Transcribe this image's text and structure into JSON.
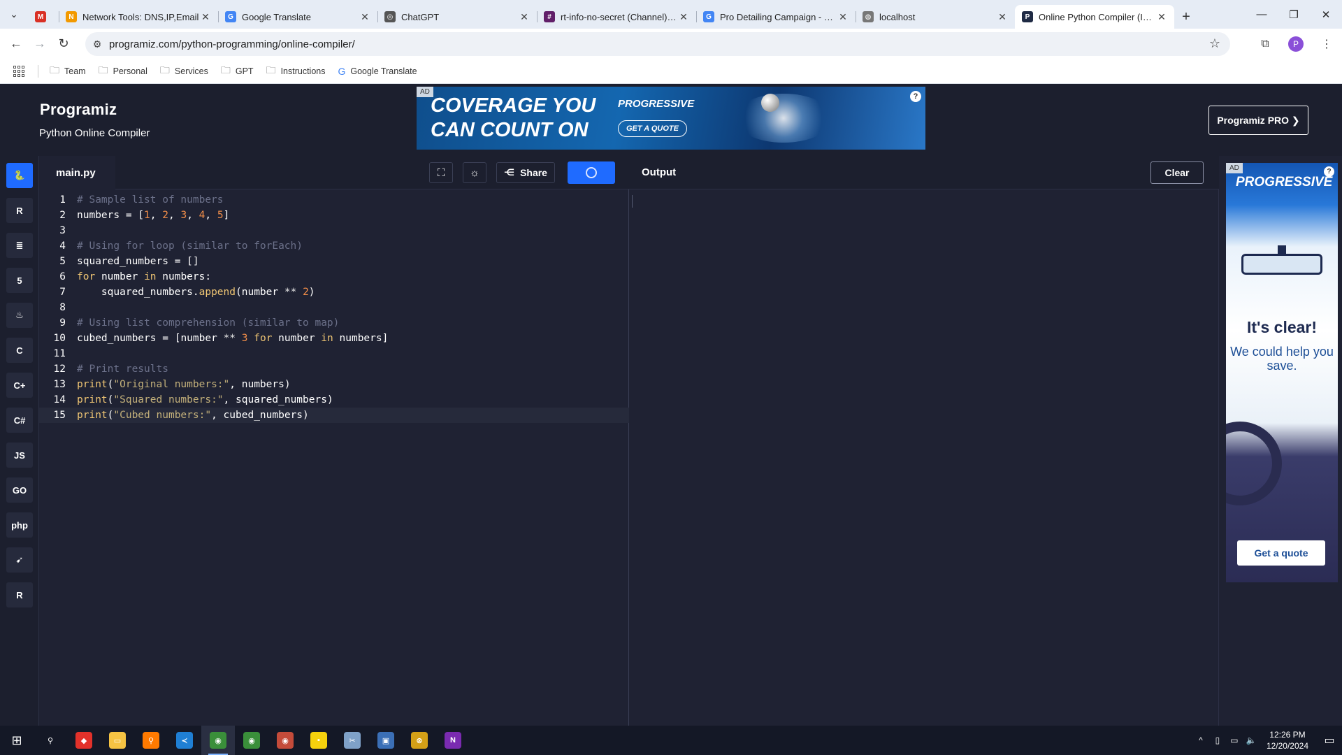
{
  "browser": {
    "tabs": [
      {
        "title": "",
        "icon": "gmail-icon",
        "color": "#d93025",
        "glyph": "M"
      },
      {
        "title": "Network Tools: DNS,IP,Email",
        "icon": "network-tools-icon",
        "color": "#f29900",
        "glyph": "N"
      },
      {
        "title": "Google Translate",
        "icon": "google-translate-icon",
        "color": "#4285f4",
        "glyph": "G"
      },
      {
        "title": "ChatGPT",
        "icon": "chatgpt-icon",
        "color": "#555555",
        "glyph": "◎"
      },
      {
        "title": "rt-info-no-secret (Channel) - n",
        "icon": "slack-icon",
        "color": "#611f69",
        "glyph": "#"
      },
      {
        "title": "Pro Detailing Campaign - Goo",
        "icon": "google-icon",
        "color": "#4285f4",
        "glyph": "G"
      },
      {
        "title": "localhost",
        "icon": "globe-icon",
        "color": "#777777",
        "glyph": "◍"
      },
      {
        "title": "Online Python Compiler (Inter",
        "icon": "programiz-icon",
        "color": "#1f2a44",
        "glyph": "P"
      }
    ],
    "url": "programiz.com/python-programming/online-compiler/",
    "profile_initial": "P",
    "bookmarks": [
      "Team",
      "Personal",
      "Services",
      "GPT",
      "Instructions",
      "Google Translate"
    ]
  },
  "site": {
    "logo": "Programiz",
    "subtitle": "Python Online Compiler",
    "pro_button": "Programiz PRO ❯",
    "top_ad": {
      "tag": "AD",
      "headline_1": "COVERAGE YOU",
      "headline_2": "CAN COUNT ON",
      "brand": "PROGRESSIVE",
      "cta": "GET A QUOTE"
    }
  },
  "languages": [
    {
      "name": "python-lang-icon",
      "glyph": "🐍",
      "active": true
    },
    {
      "name": "r-lang-icon",
      "glyph": "R",
      "active": false
    },
    {
      "name": "sql-lang-icon",
      "glyph": "≣",
      "active": false
    },
    {
      "name": "html-lang-icon",
      "glyph": "5",
      "active": false
    },
    {
      "name": "java-lang-icon",
      "glyph": "♨",
      "active": false
    },
    {
      "name": "c-lang-icon",
      "glyph": "C",
      "active": false
    },
    {
      "name": "cpp-lang-icon",
      "glyph": "C+",
      "active": false
    },
    {
      "name": "csharp-lang-icon",
      "glyph": "C#",
      "active": false
    },
    {
      "name": "js-lang-icon",
      "glyph": "JS",
      "active": false
    },
    {
      "name": "go-lang-icon",
      "glyph": "GO",
      "active": false
    },
    {
      "name": "php-lang-icon",
      "glyph": "php",
      "active": false
    },
    {
      "name": "swift-lang-icon",
      "glyph": "➹",
      "active": false
    },
    {
      "name": "rust-lang-icon",
      "glyph": "R",
      "active": false
    }
  ],
  "editor": {
    "filename": "main.py",
    "share_label": "Share",
    "lines": [
      "# Sample list of numbers",
      "numbers = [1, 2, 3, 4, 5]",
      "",
      "# Using for loop (similar to forEach)",
      "squared_numbers = []",
      "for number in numbers:",
      "    squared_numbers.append(number ** 2)",
      "",
      "# Using list comprehension (similar to map)",
      "cubed_numbers = [number ** 3 for number in numbers]",
      "",
      "# Print results",
      "print(\"Original numbers:\", numbers)",
      "print(\"Squared numbers:\", squared_numbers)",
      "print(\"Cubed numbers:\", cubed_numbers)"
    ],
    "current_line": 15
  },
  "output": {
    "title": "Output",
    "clear_label": "Clear"
  },
  "side_ad": {
    "tag": "AD",
    "brand": "PROGRESSIVE",
    "headline": "It's clear!",
    "body": "We could help you save.",
    "cta": "Get a quote"
  },
  "taskbar": {
    "apps": [
      {
        "name": "search-icon",
        "color": "transparent",
        "glyph": "⚲"
      },
      {
        "name": "anydesk-icon",
        "color": "#e2312a",
        "glyph": "◆"
      },
      {
        "name": "file-explorer-icon",
        "color": "#f6c343",
        "glyph": "▭"
      },
      {
        "name": "search-everything-icon",
        "color": "#ff7a00",
        "glyph": "⚲"
      },
      {
        "name": "vscode-icon",
        "color": "#1f7fd4",
        "glyph": "≺"
      },
      {
        "name": "chrome-icon",
        "color": "#3a8f3a",
        "glyph": "◉",
        "active": true
      },
      {
        "name": "chrome-profile-2-icon",
        "color": "#3a8f3a",
        "glyph": "◉"
      },
      {
        "name": "chrome-profile-3-icon",
        "color": "#c44b3a",
        "glyph": "◉"
      },
      {
        "name": "sticky-notes-icon",
        "color": "#f5d10d",
        "glyph": "▪"
      },
      {
        "name": "snip-tool-icon",
        "color": "#7fa1c8",
        "glyph": "✂"
      },
      {
        "name": "remote-desktop-icon",
        "color": "#3b6fb6",
        "glyph": "▣"
      },
      {
        "name": "xbox-icon",
        "color": "#d4a017",
        "glyph": "⊗"
      },
      {
        "name": "onenote-icon",
        "color": "#7a2bb0",
        "glyph": "N"
      }
    ],
    "time": "12:26 PM",
    "date": "12/20/2024"
  }
}
